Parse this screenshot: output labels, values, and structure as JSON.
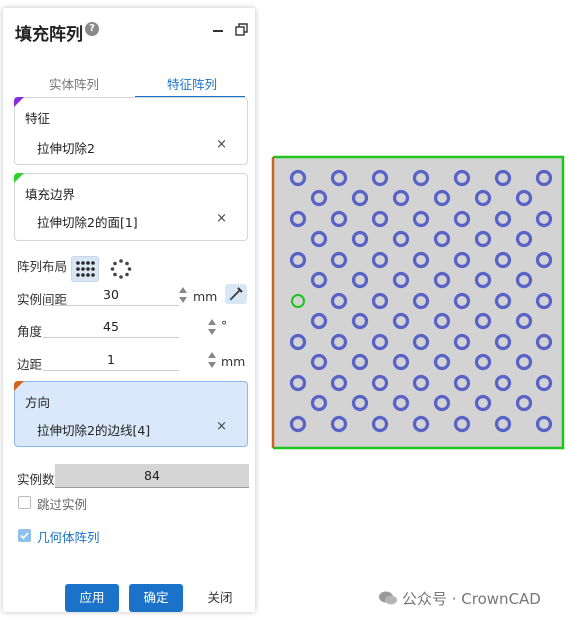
{
  "panel": {
    "title": "填充阵列",
    "help_icon": "help-icon",
    "tabs": [
      {
        "label": "实体阵列",
        "active": false
      },
      {
        "label": "特征阵列",
        "active": true
      }
    ]
  },
  "features": {
    "header": "特征",
    "value": "拉伸切除2",
    "remove": "×",
    "marker_color": "#8a2be2"
  },
  "fill_boundary": {
    "header": "填充边界",
    "value": "拉伸切除2的面[1]",
    "remove": "×",
    "marker_color": "#2bd42b"
  },
  "layout": {
    "label": "阵列布局",
    "options": [
      "grid-layout-icon",
      "circular-layout-icon"
    ],
    "selected": "grid-layout-icon"
  },
  "spacing": {
    "label": "实例间距",
    "value": "30",
    "unit": "mm"
  },
  "angle": {
    "label": "角度",
    "value": "45",
    "unit": "°"
  },
  "margin": {
    "label": "边距",
    "value": "1",
    "unit": "mm"
  },
  "direction": {
    "header": "方向",
    "value": "拉伸切除2的边线[4]",
    "remove": "×",
    "marker_color": "#d4651a"
  },
  "instance_count": {
    "label": "实例数",
    "value": "84"
  },
  "skip_instances": {
    "label": "跳过实例",
    "checked": false
  },
  "geometry_pattern": {
    "label": "几何体阵列",
    "checked": true
  },
  "buttons": {
    "apply": "应用",
    "ok": "确定",
    "close": "关闭"
  },
  "viewport": {
    "face_color": "#d3d3d3",
    "boundary_color": "#1fc41f",
    "direction_edge_color": "#c8641e",
    "hole_color": "#5863c8"
  },
  "watermark": "公众号 · CrownCAD",
  "colors": {
    "accent": "#1a73c9"
  }
}
